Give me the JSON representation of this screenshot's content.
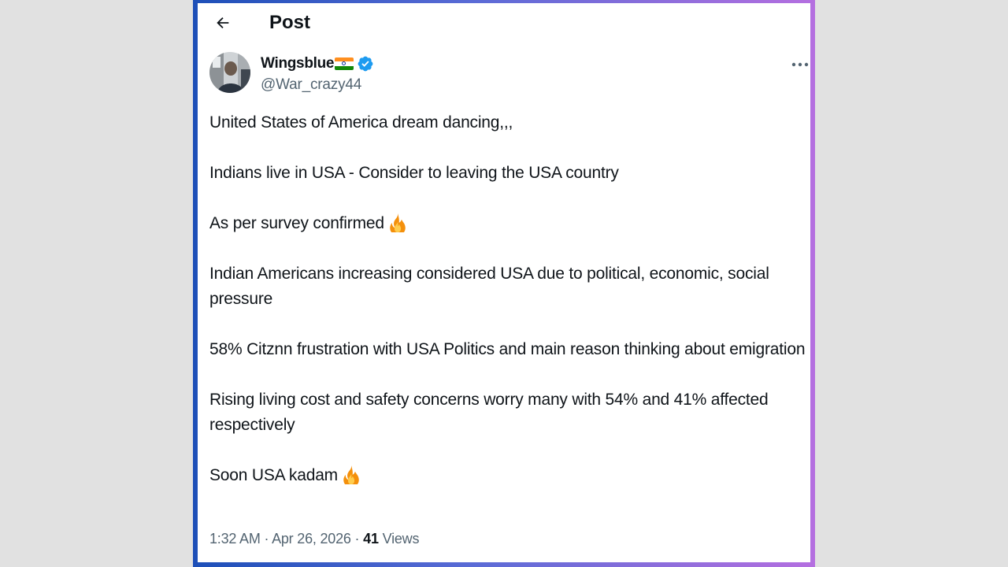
{
  "header": {
    "title": "Post",
    "back_icon": "arrow-left-icon"
  },
  "author": {
    "display_name": "Wingsblue",
    "flag_icon": "india-flag-icon",
    "verified_icon": "verified-badge-icon",
    "handle": "@War_crazy44",
    "more_icon": "more-options-icon"
  },
  "post": {
    "paragraphs": [
      "United States of America dream dancing,,,",
      "Indians live in USA - Consider to leaving the USA country",
      "As per survey confirmed",
      "Indian Americans increasing considered USA due to political, economic, social pressure",
      "58% Citznn frustration with USA Politics and main reason thinking about emigration",
      "Rising living cost and safety concerns worry many with 54% and 41% affected respectively",
      "Soon USA kadam"
    ],
    "emoji_icon": "fire-emoji-icon"
  },
  "meta": {
    "time": "1:32 AM",
    "separator": " · ",
    "date": "Apr 26, 2026",
    "views_count": "41",
    "views_label": "Views"
  },
  "colors": {
    "text_primary": "#0f1419",
    "text_secondary": "#536471",
    "verified_blue": "#1d9bf0",
    "frame_gradient_start": "#1d4fb8",
    "frame_gradient_end": "#b56fe0",
    "page_background": "#e1e1e1"
  }
}
